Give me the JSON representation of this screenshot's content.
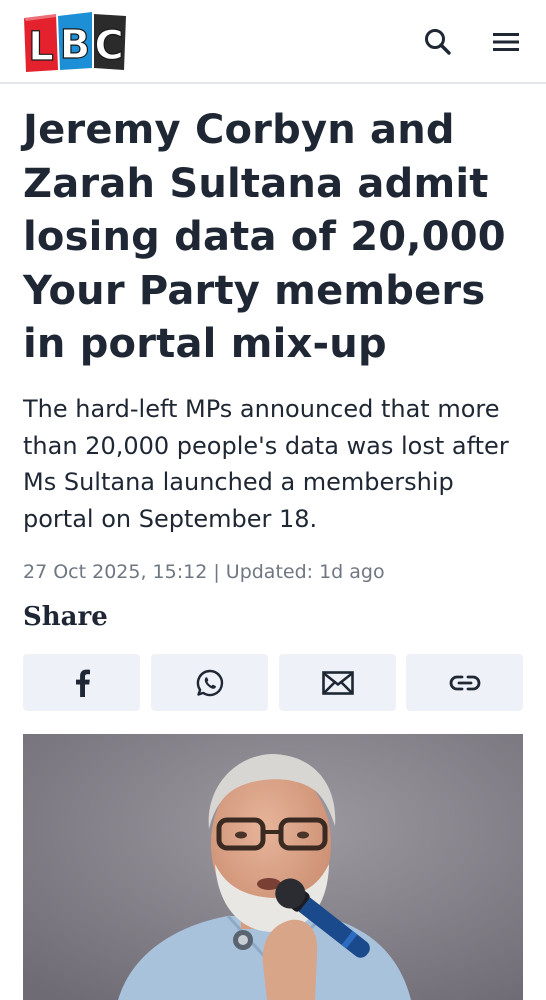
{
  "header": {
    "logo_text": "LBC",
    "logo_icon": "lbc-logo",
    "search_icon": "search-icon",
    "menu_icon": "hamburger-menu-icon",
    "colors": {
      "logo_l": "#e4222e",
      "logo_b": "#1d8fd6",
      "logo_c": "#2b2b2b"
    }
  },
  "article": {
    "headline": "Jeremy Corbyn and Zarah Sultana admit losing data of 20,000 Your Party members in portal mix-up",
    "standfirst": "The hard-left MPs announced that more than 20,000 people's data was lost after Ms Sultana launched a membership portal on September 18.",
    "published": "27 Oct 2025, 15:12",
    "separator": " | ",
    "updated": "Updated: 1d ago"
  },
  "share": {
    "label": "Share",
    "buttons": [
      {
        "icon": "facebook-icon"
      },
      {
        "icon": "whatsapp-icon"
      },
      {
        "icon": "email-icon"
      },
      {
        "icon": "copy-link-icon"
      }
    ]
  },
  "hero_image": {
    "subject": "man-with-glasses-speaking-into-microphone"
  },
  "colors": {
    "text": "#1e2733",
    "meta": "#6f7782",
    "share_button_bg": "#eef2f8"
  }
}
